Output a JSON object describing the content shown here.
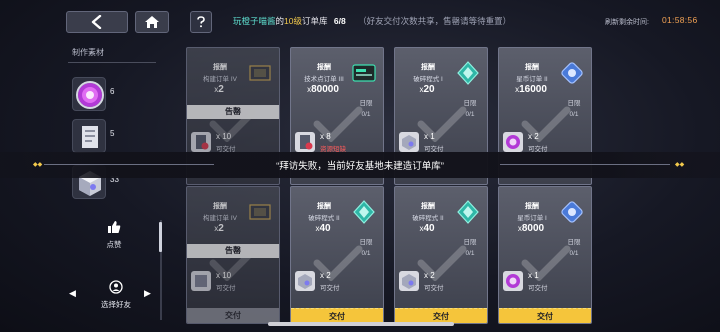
{
  "header": {
    "friend_name": "玩橙子喵酱",
    "of": "的",
    "level": "10级",
    "library": "订单库",
    "count": "6/8",
    "note": "（好友交付次数共享，售罄请等待重置）",
    "refresh_label": "刷新剩余时间:",
    "refresh_time": "01:58:56"
  },
  "sidebar": {
    "materials_title": "制作素材",
    "materials": [
      {
        "count": "6"
      },
      {
        "count": "5"
      },
      {
        "count": "33"
      }
    ],
    "like_label": "点赞",
    "select_friend_label": "选择好友"
  },
  "reward_label": "报酬",
  "limit_label": "日限",
  "toast": "“拜访失败，当前好友基地未建造订单库”",
  "cards": [
    {
      "name": "构建订单 IV",
      "qty": "2",
      "limit": "",
      "sold_out": "告罄",
      "req_qty": "x 10",
      "req_status": "可交付",
      "req_red": false,
      "deliver": "",
      "deliver_style": "none",
      "dim": true
    },
    {
      "name": "技术点订单 III",
      "qty": "80000",
      "limit": "0/1",
      "sold_out": "",
      "req_qty": "x 8",
      "req_status": "资源短缺",
      "req_red": true,
      "deliver": "",
      "deliver_style": "none",
      "dim": false
    },
    {
      "name": "破碎程式 I",
      "qty": "20",
      "limit": "0/1",
      "sold_out": "",
      "req_qty": "x 1",
      "req_status": "可交付",
      "req_red": false,
      "deliver": "",
      "deliver_style": "none",
      "dim": false
    },
    {
      "name": "星币订单 II",
      "qty": "16000",
      "limit": "0/1",
      "sold_out": "",
      "req_qty": "x 2",
      "req_status": "可交付",
      "req_red": false,
      "deliver": "",
      "deliver_style": "none",
      "dim": false
    },
    {
      "name": "构建订单 IV",
      "qty": "2",
      "limit": "",
      "sold_out": "告罄",
      "req_qty": "x 10",
      "req_status": "可交付",
      "req_red": false,
      "deliver": "交付",
      "deliver_style": "gray",
      "dim": true
    },
    {
      "name": "破碎程式 II",
      "qty": "40",
      "limit": "0/1",
      "sold_out": "",
      "req_qty": "x 2",
      "req_status": "可交付",
      "req_red": false,
      "deliver": "交付",
      "deliver_style": "gold",
      "dim": false
    },
    {
      "name": "破碎程式 II",
      "qty": "40",
      "limit": "0/1",
      "sold_out": "",
      "req_qty": "x 2",
      "req_status": "可交付",
      "req_red": false,
      "deliver": "交付",
      "deliver_style": "gold",
      "dim": false
    },
    {
      "name": "星币订单 I",
      "qty": "8000",
      "limit": "0/1",
      "sold_out": "",
      "req_qty": "x 1",
      "req_status": "可交付",
      "req_red": false,
      "deliver": "交付",
      "deliver_style": "gold",
      "dim": false
    }
  ],
  "icons": {
    "back": "back-arrow-icon",
    "home": "home-icon",
    "help": "help-icon",
    "like": "thumbs-up-icon",
    "friend": "friend-icon"
  },
  "colors": {
    "accent_teal": "#5fe0d0",
    "accent_gold": "#f5c53b",
    "timer": "#f2a254",
    "warning_red": "#ff5b5b"
  }
}
